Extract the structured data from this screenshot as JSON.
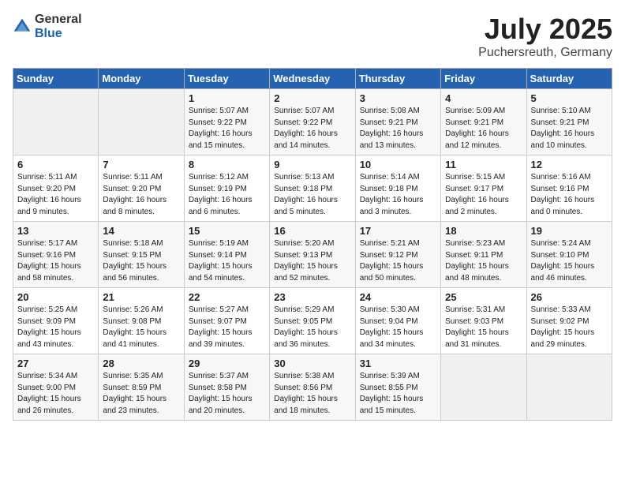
{
  "logo": {
    "general": "General",
    "blue": "Blue"
  },
  "title": "July 2025",
  "location": "Puchersreuth, Germany",
  "weekdays": [
    "Sunday",
    "Monday",
    "Tuesday",
    "Wednesday",
    "Thursday",
    "Friday",
    "Saturday"
  ],
  "weeks": [
    [
      {
        "day": "",
        "info": ""
      },
      {
        "day": "",
        "info": ""
      },
      {
        "day": "1",
        "info": "Sunrise: 5:07 AM\nSunset: 9:22 PM\nDaylight: 16 hours\nand 15 minutes."
      },
      {
        "day": "2",
        "info": "Sunrise: 5:07 AM\nSunset: 9:22 PM\nDaylight: 16 hours\nand 14 minutes."
      },
      {
        "day": "3",
        "info": "Sunrise: 5:08 AM\nSunset: 9:21 PM\nDaylight: 16 hours\nand 13 minutes."
      },
      {
        "day": "4",
        "info": "Sunrise: 5:09 AM\nSunset: 9:21 PM\nDaylight: 16 hours\nand 12 minutes."
      },
      {
        "day": "5",
        "info": "Sunrise: 5:10 AM\nSunset: 9:21 PM\nDaylight: 16 hours\nand 10 minutes."
      }
    ],
    [
      {
        "day": "6",
        "info": "Sunrise: 5:11 AM\nSunset: 9:20 PM\nDaylight: 16 hours\nand 9 minutes."
      },
      {
        "day": "7",
        "info": "Sunrise: 5:11 AM\nSunset: 9:20 PM\nDaylight: 16 hours\nand 8 minutes."
      },
      {
        "day": "8",
        "info": "Sunrise: 5:12 AM\nSunset: 9:19 PM\nDaylight: 16 hours\nand 6 minutes."
      },
      {
        "day": "9",
        "info": "Sunrise: 5:13 AM\nSunset: 9:18 PM\nDaylight: 16 hours\nand 5 minutes."
      },
      {
        "day": "10",
        "info": "Sunrise: 5:14 AM\nSunset: 9:18 PM\nDaylight: 16 hours\nand 3 minutes."
      },
      {
        "day": "11",
        "info": "Sunrise: 5:15 AM\nSunset: 9:17 PM\nDaylight: 16 hours\nand 2 minutes."
      },
      {
        "day": "12",
        "info": "Sunrise: 5:16 AM\nSunset: 9:16 PM\nDaylight: 16 hours\nand 0 minutes."
      }
    ],
    [
      {
        "day": "13",
        "info": "Sunrise: 5:17 AM\nSunset: 9:16 PM\nDaylight: 15 hours\nand 58 minutes."
      },
      {
        "day": "14",
        "info": "Sunrise: 5:18 AM\nSunset: 9:15 PM\nDaylight: 15 hours\nand 56 minutes."
      },
      {
        "day": "15",
        "info": "Sunrise: 5:19 AM\nSunset: 9:14 PM\nDaylight: 15 hours\nand 54 minutes."
      },
      {
        "day": "16",
        "info": "Sunrise: 5:20 AM\nSunset: 9:13 PM\nDaylight: 15 hours\nand 52 minutes."
      },
      {
        "day": "17",
        "info": "Sunrise: 5:21 AM\nSunset: 9:12 PM\nDaylight: 15 hours\nand 50 minutes."
      },
      {
        "day": "18",
        "info": "Sunrise: 5:23 AM\nSunset: 9:11 PM\nDaylight: 15 hours\nand 48 minutes."
      },
      {
        "day": "19",
        "info": "Sunrise: 5:24 AM\nSunset: 9:10 PM\nDaylight: 15 hours\nand 46 minutes."
      }
    ],
    [
      {
        "day": "20",
        "info": "Sunrise: 5:25 AM\nSunset: 9:09 PM\nDaylight: 15 hours\nand 43 minutes."
      },
      {
        "day": "21",
        "info": "Sunrise: 5:26 AM\nSunset: 9:08 PM\nDaylight: 15 hours\nand 41 minutes."
      },
      {
        "day": "22",
        "info": "Sunrise: 5:27 AM\nSunset: 9:07 PM\nDaylight: 15 hours\nand 39 minutes."
      },
      {
        "day": "23",
        "info": "Sunrise: 5:29 AM\nSunset: 9:05 PM\nDaylight: 15 hours\nand 36 minutes."
      },
      {
        "day": "24",
        "info": "Sunrise: 5:30 AM\nSunset: 9:04 PM\nDaylight: 15 hours\nand 34 minutes."
      },
      {
        "day": "25",
        "info": "Sunrise: 5:31 AM\nSunset: 9:03 PM\nDaylight: 15 hours\nand 31 minutes."
      },
      {
        "day": "26",
        "info": "Sunrise: 5:33 AM\nSunset: 9:02 PM\nDaylight: 15 hours\nand 29 minutes."
      }
    ],
    [
      {
        "day": "27",
        "info": "Sunrise: 5:34 AM\nSunset: 9:00 PM\nDaylight: 15 hours\nand 26 minutes."
      },
      {
        "day": "28",
        "info": "Sunrise: 5:35 AM\nSunset: 8:59 PM\nDaylight: 15 hours\nand 23 minutes."
      },
      {
        "day": "29",
        "info": "Sunrise: 5:37 AM\nSunset: 8:58 PM\nDaylight: 15 hours\nand 20 minutes."
      },
      {
        "day": "30",
        "info": "Sunrise: 5:38 AM\nSunset: 8:56 PM\nDaylight: 15 hours\nand 18 minutes."
      },
      {
        "day": "31",
        "info": "Sunrise: 5:39 AM\nSunset: 8:55 PM\nDaylight: 15 hours\nand 15 minutes."
      },
      {
        "day": "",
        "info": ""
      },
      {
        "day": "",
        "info": ""
      }
    ]
  ]
}
